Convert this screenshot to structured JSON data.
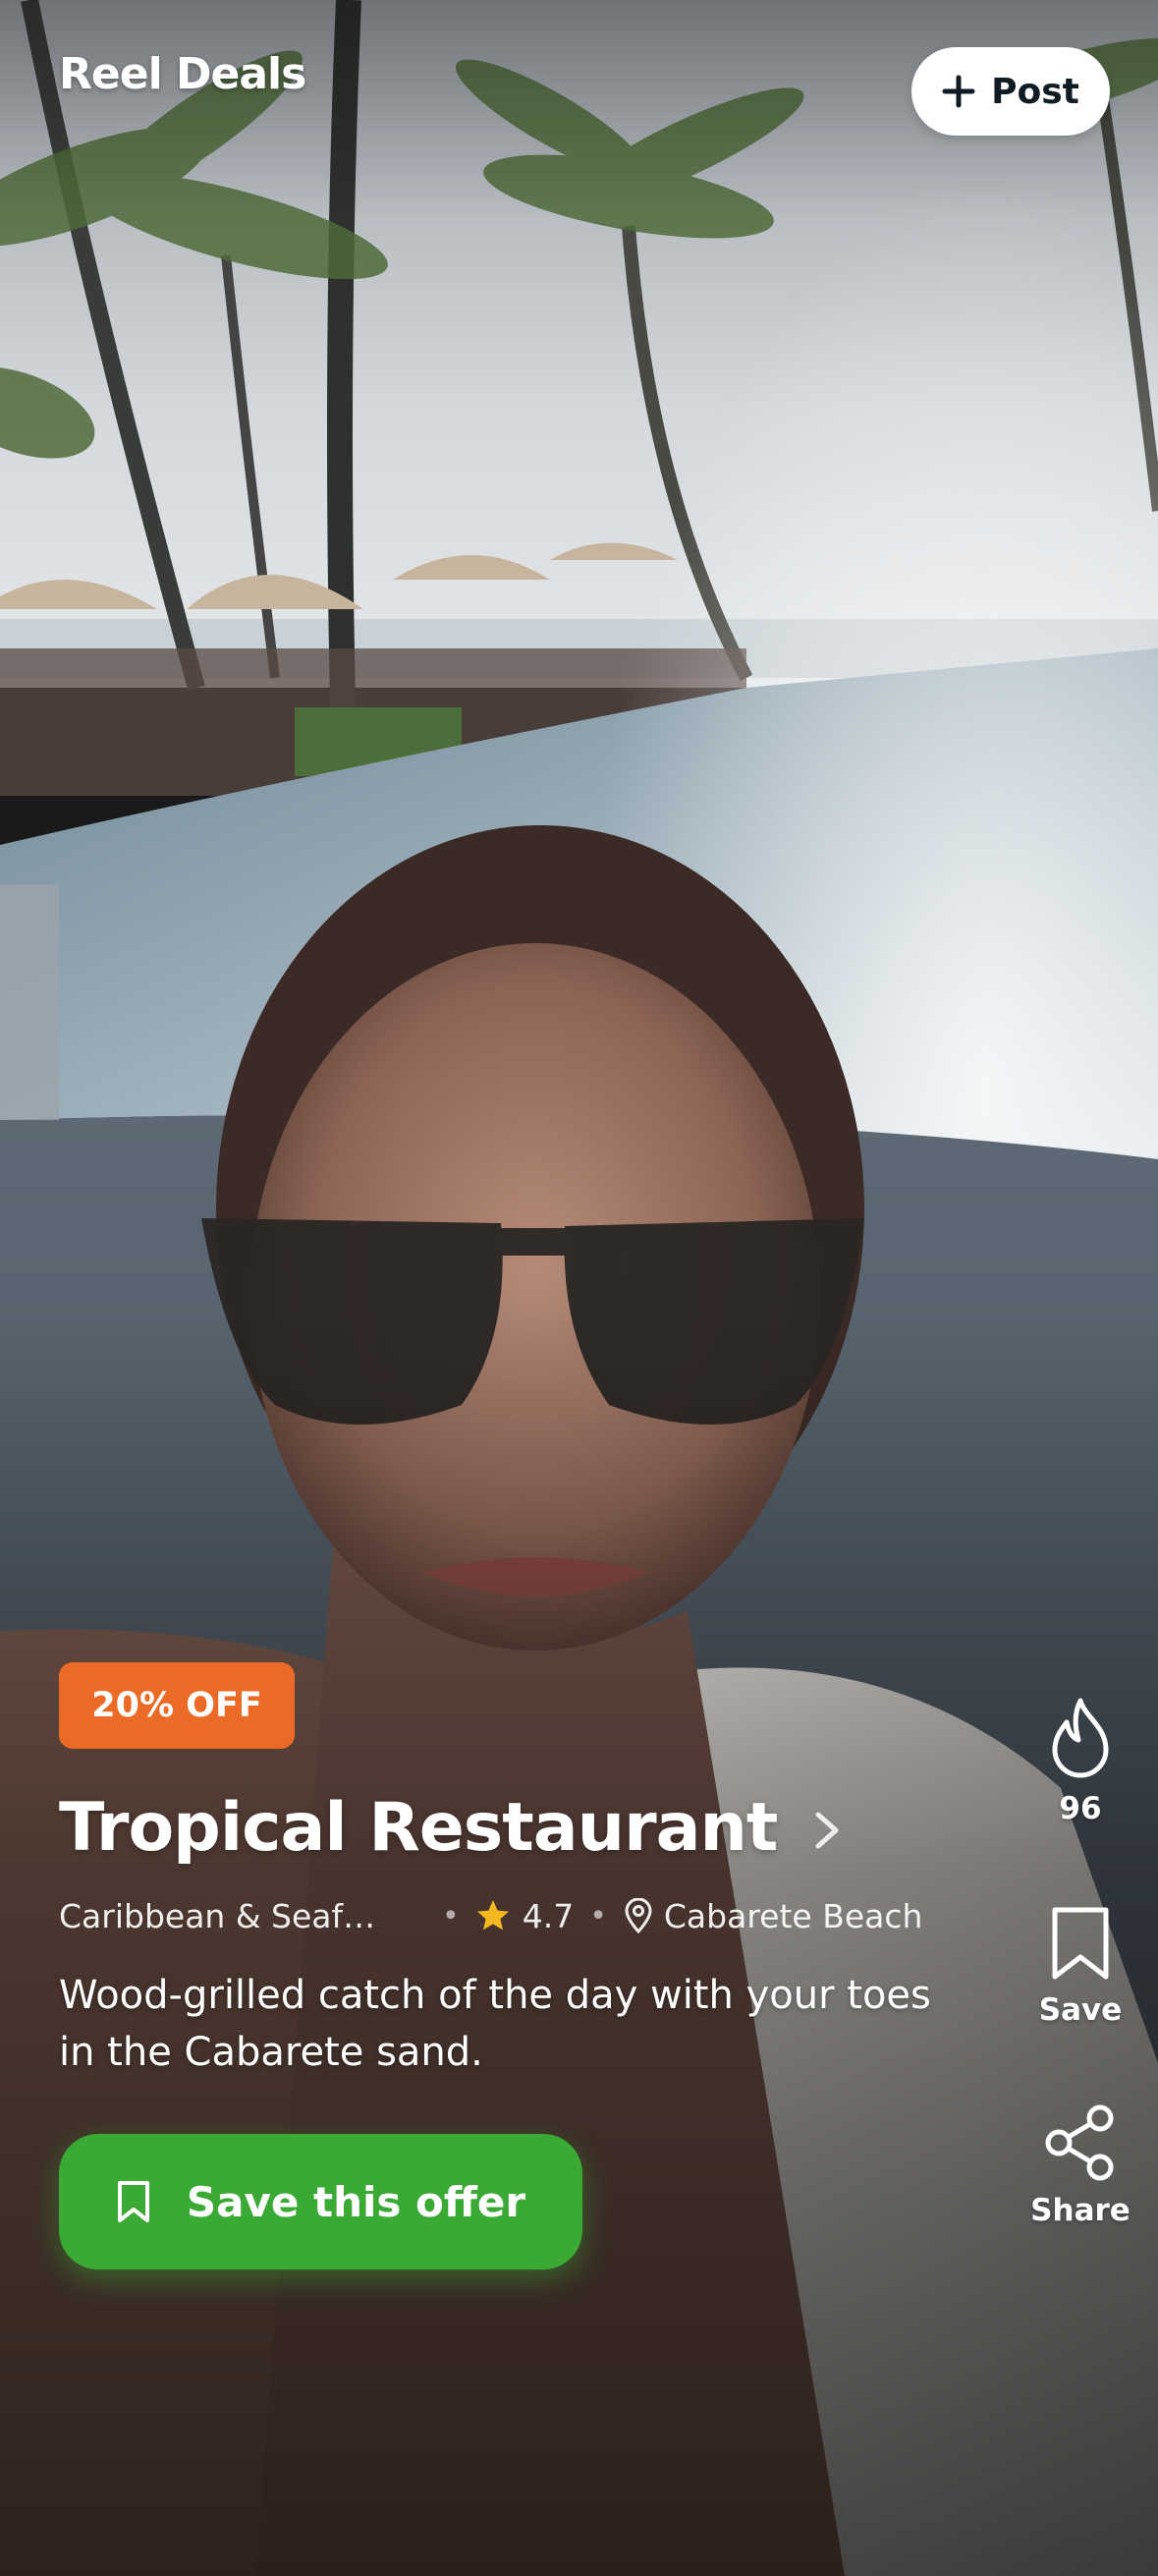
{
  "header": {
    "brand": "Reel Deals",
    "post_label": "Post"
  },
  "video": {
    "background": "tropical pool selfie"
  },
  "offer": {
    "badge": "20% OFF",
    "title": "Tropical Restaurant",
    "category": "Caribbean & Seaf…",
    "rating": "4.7",
    "location": "Cabarete Beach",
    "description": "Wood-grilled catch of the day with your toes in the Cabarete sand.",
    "cta_label": "Save this offer"
  },
  "actions": {
    "fire_count": "96",
    "save_label": "Save",
    "share_label": "Share"
  },
  "colors": {
    "badge": "#ea6a26",
    "cta": "#3aaa35",
    "star": "#f5b91f",
    "post_text": "#0f1c24"
  },
  "icons": [
    "plus-icon",
    "chevron-right-icon",
    "star-icon",
    "location-pin-icon",
    "bookmark-icon",
    "fire-icon",
    "share-icon"
  ]
}
